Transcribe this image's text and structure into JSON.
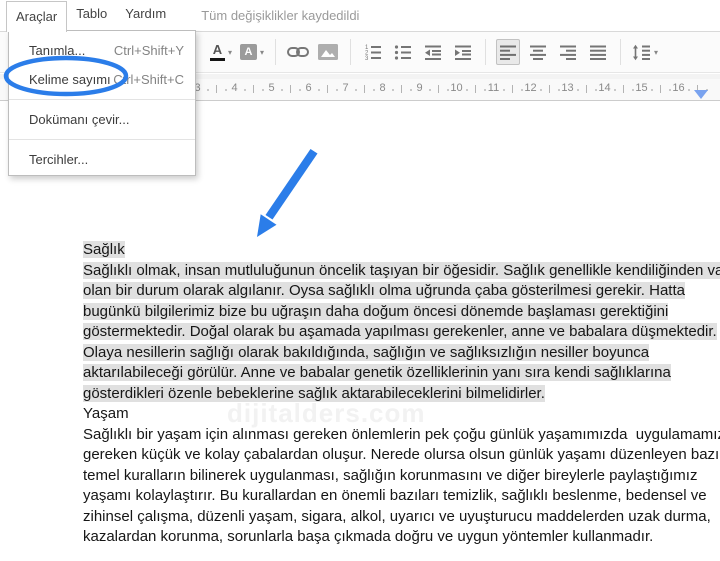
{
  "menubar": {
    "items": [
      {
        "id": "araclar",
        "label": "Araçlar",
        "open": true
      },
      {
        "id": "tablo",
        "label": "Tablo",
        "open": false
      },
      {
        "id": "yardim",
        "label": "Yardım",
        "open": false
      }
    ],
    "status": "Tüm değişiklikler kaydedildi"
  },
  "dropdown": {
    "items": [
      {
        "type": "item",
        "id": "tanimla",
        "label": "Tanımla...",
        "shortcut": "Ctrl+Shift+Y",
        "circled": false
      },
      {
        "type": "item",
        "id": "kelime-sayimi",
        "label": "Kelime sayımı",
        "shortcut": "Ctrl+Shift+C",
        "circled": true
      },
      {
        "type": "separator"
      },
      {
        "type": "item",
        "id": "dokumani-cevir",
        "label": "Dokümanı çevir...",
        "shortcut": "",
        "circled": false
      },
      {
        "type": "separator"
      },
      {
        "type": "item",
        "id": "tercihler",
        "label": "Tercihler...",
        "shortcut": "",
        "circled": false
      }
    ]
  },
  "toolbar": {
    "icons": [
      "text-color",
      "highlight-color",
      "insert-link",
      "insert-image",
      "numbered-list",
      "bulleted-list",
      "decrease-indent",
      "increase-indent",
      "align-left",
      "align-center",
      "align-right",
      "justify",
      "line-spacing"
    ],
    "active_icon": "align-left",
    "text_color_glyph": "A",
    "highlight_glyph": "A"
  },
  "ruler": {
    "numbers": [
      3,
      4,
      5,
      6,
      7,
      8,
      9,
      10,
      11,
      12,
      13,
      14,
      15,
      16
    ]
  },
  "document": {
    "sections": [
      {
        "heading": "Sağlık",
        "selected": true,
        "lines": [
          "Sağlıklı olmak, insan mutluluğunun öncelik taşıyan bir öğesidir. Sağlık genellikle kendiliğinden var",
          "olan bir durum olarak algılanır. Oysa sağlıklı olma uğrunda çaba gösterilmesi gerekir. Hatta",
          "bugünkü bilgilerimiz bize bu uğraşın daha doğum öncesi dönemde başlaması gerektiğini",
          "göstermektedir. Doğal olarak bu aşamada yapılması gerekenler, anne ve babalara düşmektedir.",
          "Olaya nesillerin sağlığı olarak bakıldığında, sağlığın ve sağlıksızlığın nesiller boyunca",
          "aktarılabileceği görülür. Anne ve babalar genetik özelliklerinin yanı sıra kendi sağlıklarına",
          "gösterdikleri özenle bebeklerine sağlık aktarabileceklerini bilmelidirler."
        ]
      },
      {
        "heading": "Yaşam",
        "selected": false,
        "lines": [
          "Sağlıklı bir yaşam için alınması gereken önlemlerin pek çoğu günlük yaşamımızda  uygulamamız",
          "gereken küçük ve kolay çabalardan oluşur. Nerede olursa olsun günlük yaşamı düzenleyen bazı",
          "temel kuralların bilinerek uygulanması, sağlığın korunmasını ve diğer bireylerle paylaştığımız",
          "yaşamı kolaylaştırır. Bu kurallardan en önemli bazıları temizlik, sağlıklı beslenme, bedensel ve",
          "zihinsel çalışma, düzenli yaşam, sigara, alkol, uyarıcı ve uyuşturucu maddelerden uzak durma,",
          "kazalardan korunma, sorunlarla başa çıkmada doğru ve uygun yöntemler kullanmadır."
        ]
      }
    ]
  },
  "watermark": "dijitalders.com",
  "colors": {
    "accent": "#2b7de9",
    "selection": "#e0e0e0",
    "watermark": "#f2f2f2",
    "marker": "#7aa3ef"
  }
}
